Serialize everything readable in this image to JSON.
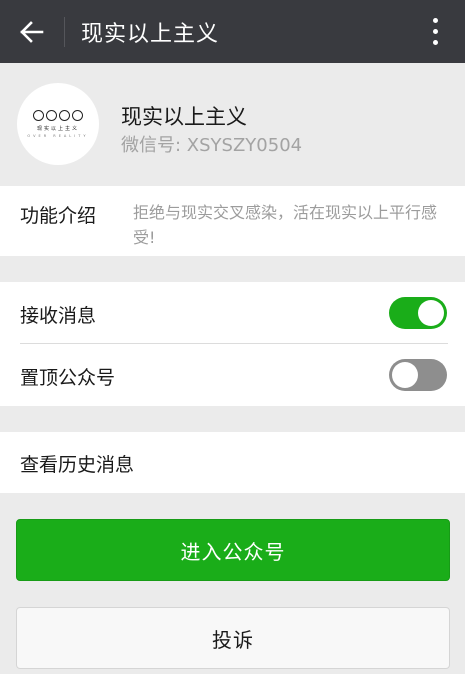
{
  "header": {
    "title": "现实以上主义",
    "back_icon": "arrow-left-icon",
    "more_icon": "more-vertical-icon"
  },
  "profile": {
    "name": "现实以上主义",
    "wechat_id": "微信号: XSYSZY0504",
    "avatar_text": "现实以上主义",
    "avatar_sub": "OVER REALITY"
  },
  "intro": {
    "label": "功能介绍",
    "value": "拒绝与现实交叉感染，活在现实以上平行感受!"
  },
  "settings": {
    "receive_messages": {
      "label": "接收消息",
      "state": "on"
    },
    "pin_account": {
      "label": "置顶公众号",
      "state": "off"
    }
  },
  "history": {
    "label": "查看历史消息"
  },
  "actions": {
    "enter_label": "进入公众号",
    "report_label": "投诉"
  },
  "colors": {
    "header_bg": "#393a3f",
    "accent_green": "#1aad19",
    "page_bg": "#ebebeb"
  }
}
